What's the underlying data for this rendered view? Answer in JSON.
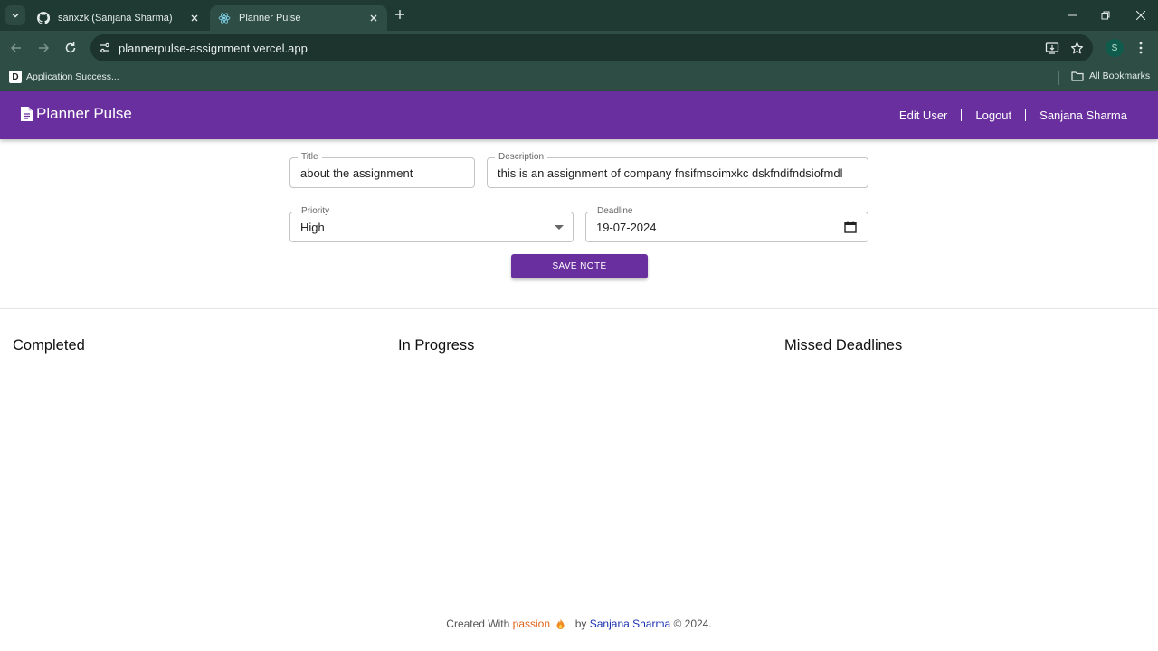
{
  "browser": {
    "tabs": [
      {
        "title": "sanxzk (Sanjana Sharma)",
        "icon": "github-icon"
      },
      {
        "title": "Planner Pulse",
        "icon": "react-icon",
        "active": true
      }
    ],
    "url": "plannerpulse-assignment.vercel.app",
    "profile_initial": "S",
    "bookmarks": {
      "first_icon_letter": "D",
      "first": "Application Success...",
      "all_label": "All Bookmarks"
    }
  },
  "app": {
    "brand": "Planner Pulse",
    "nav": {
      "edit_user": "Edit User",
      "logout": "Logout",
      "user_name": "Sanjana Sharma"
    },
    "form": {
      "title_label": "Title",
      "title_value": "about the assignment",
      "description_label": "Description",
      "description_value": "this is an assignment of company fnsifmsoimxkc dskfndifndsiofmdl",
      "priority_label": "Priority",
      "priority_value": "High",
      "deadline_label": "Deadline",
      "deadline_value": "19-07-2024",
      "save_label": "SAVE NOTE"
    },
    "columns": {
      "completed": "Completed",
      "in_progress": "In Progress",
      "missed": "Missed Deadlines"
    },
    "footer": {
      "prefix": "Created With",
      "passion": "passion",
      "by": "by",
      "author": "Sanjana Sharma",
      "suffix": "© 2024."
    }
  },
  "colors": {
    "accent": "#6a2f9e",
    "chrome": "#2e4d45",
    "passion": "#e0641a",
    "author_link": "#1a2fb0"
  }
}
